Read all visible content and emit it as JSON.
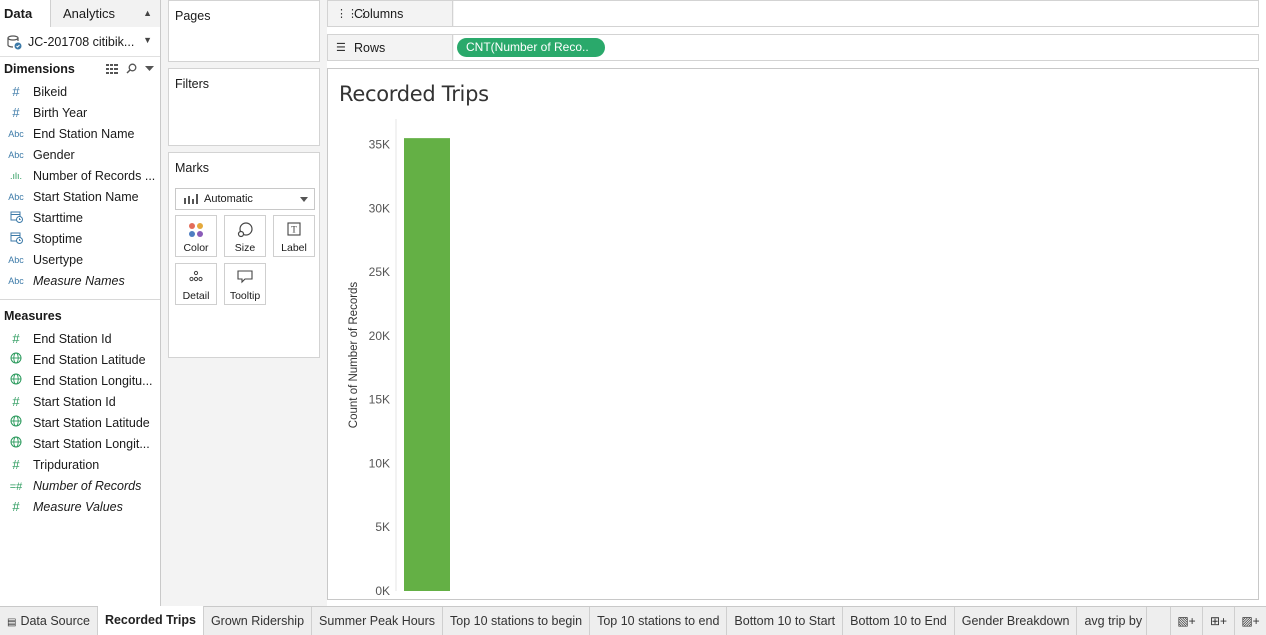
{
  "data_pane": {
    "tabs": [
      "Data",
      "Analytics"
    ],
    "source": "JC-201708 citibik...",
    "dimensions_title": "Dimensions",
    "dimensions": [
      {
        "icon": "#",
        "name": "Bikeid",
        "italic": false
      },
      {
        "icon": "#",
        "name": "Birth Year",
        "italic": false
      },
      {
        "icon": "Abc",
        "name": "End Station Name",
        "italic": false
      },
      {
        "icon": "Abc",
        "name": "Gender",
        "italic": false
      },
      {
        "icon": ".ılı.",
        "name": "Number of Records ...",
        "italic": false
      },
      {
        "icon": "Abc",
        "name": "Start Station Name",
        "italic": false
      },
      {
        "icon": "cal",
        "name": "Starttime",
        "italic": false
      },
      {
        "icon": "cal",
        "name": "Stoptime",
        "italic": false
      },
      {
        "icon": "Abc",
        "name": "Usertype",
        "italic": false
      },
      {
        "icon": "Abc",
        "name": "Measure Names",
        "italic": true
      }
    ],
    "measures_title": "Measures",
    "measures": [
      {
        "icon": "#",
        "name": "End Station Id",
        "italic": false
      },
      {
        "icon": "globe",
        "name": "End Station Latitude",
        "italic": false
      },
      {
        "icon": "globe",
        "name": "End Station Longitu...",
        "italic": false
      },
      {
        "icon": "#",
        "name": "Start Station Id",
        "italic": false
      },
      {
        "icon": "globe",
        "name": "Start Station Latitude",
        "italic": false
      },
      {
        "icon": "globe",
        "name": "Start Station Longit...",
        "italic": false
      },
      {
        "icon": "#",
        "name": "Tripduration",
        "italic": false
      },
      {
        "icon": "=#",
        "name": "Number of Records",
        "italic": true
      },
      {
        "icon": "#",
        "name": "Measure Values",
        "italic": true
      }
    ]
  },
  "cards": {
    "pages": "Pages",
    "filters": "Filters",
    "marks": "Marks",
    "mark_type": "Automatic",
    "mark_buttons": [
      "Color",
      "Size",
      "Label",
      "Detail",
      "Tooltip"
    ]
  },
  "shelves": {
    "columns_label": "Columns",
    "rows_label": "Rows",
    "rows_pill": "CNT(Number of Reco.."
  },
  "view": {
    "title": "Recorded Trips"
  },
  "chart_data": {
    "type": "bar",
    "title": "Recorded Trips",
    "ylabel": "Count of Number of Records",
    "xlabel": "",
    "categories": [
      ""
    ],
    "values": [
      35500
    ],
    "ylim": [
      0,
      37000
    ],
    "yticks": [
      0,
      5000,
      10000,
      15000,
      20000,
      25000,
      30000,
      35000
    ],
    "ytick_labels": [
      "0K",
      "5K",
      "10K",
      "15K",
      "20K",
      "25K",
      "30K",
      "35K"
    ],
    "bar_color": "#64b045",
    "grid": false
  },
  "sheet_tabs": [
    "Data Source",
    "Recorded Trips",
    "Grown Ridership",
    "Summer Peak Hours",
    "Top 10 stations to begin",
    "Top 10 stations to end",
    "Bottom 10 to Start",
    "Bottom 10 to End",
    "Gender Breakdown",
    "avg trip by"
  ],
  "active_tab": "Recorded Trips",
  "colors": {
    "pill": "#2aa96b",
    "bar": "#64b045",
    "dimension_icon": "#3c7aa8",
    "measure_icon": "#2a9a5c"
  }
}
